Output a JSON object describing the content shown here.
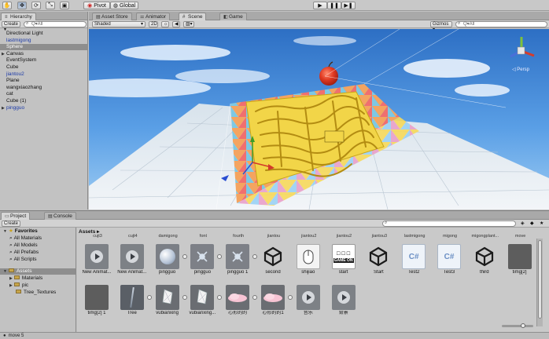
{
  "toolbar": {
    "pivot": "Pivot",
    "global": "Global"
  },
  "hierarchy": {
    "tab": "Hierarchy",
    "create": "Create",
    "search_placeholder": "Q▾All",
    "items": [
      {
        "label": "Directional Light",
        "color": "black"
      },
      {
        "label": "lastmigong",
        "color": "blue"
      },
      {
        "label": "Sphere",
        "color": "selected"
      },
      {
        "label": "Canvas",
        "color": "black",
        "arrow": "▶"
      },
      {
        "label": "EventSystem",
        "color": "black"
      },
      {
        "label": "Cube",
        "color": "black"
      },
      {
        "label": "jiantou2",
        "color": "blue"
      },
      {
        "label": "Plane",
        "color": "black"
      },
      {
        "label": "wangxiaozhang",
        "color": "black"
      },
      {
        "label": "cat",
        "color": "black"
      },
      {
        "label": "Cube (1)",
        "color": "black"
      },
      {
        "label": "pingguo",
        "color": "blue",
        "arrow": "▶"
      }
    ]
  },
  "scene": {
    "tabs": [
      "Asset Store",
      "Animator",
      "Scene",
      "Game"
    ],
    "shading": "Shaded",
    "mode_2d": "2D",
    "gizmos": "Gizmos ▾",
    "search_placeholder": "Q▾All",
    "persp": "◁ Persp"
  },
  "project": {
    "tabs": [
      "Project",
      "Console"
    ],
    "create": "Create",
    "favorites": "Favorites",
    "fav_items": [
      "All Materials",
      "All Models",
      "All Prefabs",
      "All Scripts"
    ],
    "assets_root": "Assets",
    "folders": [
      "Materials",
      "pic",
      "Tree_Textures"
    ],
    "breadcrumb": "Assets ▸",
    "top_labels": [
      "cujt3",
      "cujt4",
      "damigong",
      "font",
      "fourth",
      "jiantou",
      "jiantou2",
      "jiantou2",
      "jiantou3",
      "lastmigong",
      "migong",
      "migongplant...",
      "move"
    ],
    "row1": [
      {
        "label": "New Animat...",
        "kind": "clip"
      },
      {
        "label": "New Animat...",
        "kind": "clip"
      },
      {
        "label": "pingguo",
        "kind": "sphere"
      },
      {
        "label": "pingguo",
        "kind": "prefab"
      },
      {
        "label": "pingguo 1",
        "kind": "prefab"
      },
      {
        "label": "second",
        "kind": "unity"
      },
      {
        "label": "shijiao",
        "kind": "mouse"
      },
      {
        "label": "start",
        "kind": "gameon"
      },
      {
        "label": "Start",
        "kind": "unity"
      },
      {
        "label": "Test2",
        "kind": "cs"
      },
      {
        "label": "Test3",
        "kind": "cs"
      },
      {
        "label": "third",
        "kind": "unity"
      },
      {
        "label": "timg[2]",
        "kind": "dark"
      }
    ],
    "row2": [
      {
        "label": "timg[2] 1",
        "kind": "dark"
      },
      {
        "label": "Tree",
        "kind": "tree"
      },
      {
        "label": "vubianxing",
        "kind": "crystal"
      },
      {
        "label": "vubianxing...",
        "kind": "crystal"
      },
      {
        "label": "心形的的",
        "kind": "cloud"
      },
      {
        "label": "心形的的1",
        "kind": "cloud"
      },
      {
        "label": "音乐",
        "kind": "clip"
      },
      {
        "label": "背景",
        "kind": "clip"
      }
    ],
    "cs_text": "C#",
    "gameon_text": "GAME ON"
  },
  "status": "move 5"
}
